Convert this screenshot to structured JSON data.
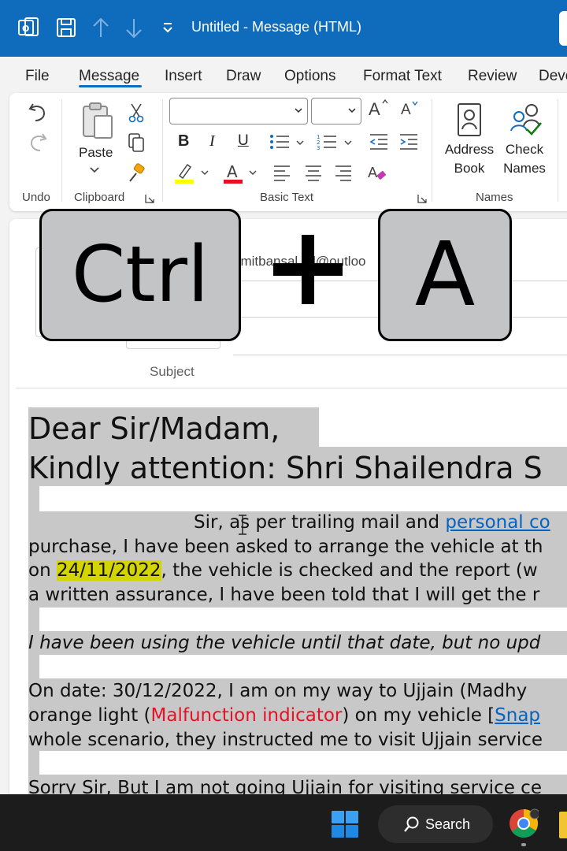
{
  "titlebar": {
    "title": "Untitled  -  Message (HTML)",
    "bg_color": "#0f6cbd"
  },
  "menu": {
    "tabs": [
      "File",
      "Message",
      "Insert",
      "Draw",
      "Options",
      "Format Text",
      "Review",
      "Deve"
    ],
    "active": "Message"
  },
  "ribbon": {
    "groups": {
      "undo": "Undo",
      "clipboard": "Clipboard",
      "basic_text": "Basic Text",
      "names": "Names"
    },
    "paste_label": "Paste",
    "bold": "B",
    "italic": "I",
    "underline": "U",
    "address_book": [
      "Address",
      "Book"
    ],
    "check_names": [
      "Check",
      "Names"
    ],
    "grow_font": "A",
    "shrink_font": "A"
  },
  "compose": {
    "to_value": "amitbansal_ol@outloo",
    "subject_label": "Subject"
  },
  "shortcut_overlay": {
    "key1": "Ctrl",
    "plus": "+",
    "key2": "A"
  },
  "email_body": {
    "greeting": "Dear Sir/Madam,",
    "attention": "Kindly attention: Shri Shailendra S",
    "p1_line1_a": "Sir, as per trailing mail and ",
    "p1_line1_link": "personal co",
    "p1_line2": "purchase, I have been asked to arrange the vehicle at th",
    "p1_line3_a": "on ",
    "p1_line3_date": "24/11/2022",
    "p1_line3_b": ", the vehicle is checked and the report (w",
    "p1_line4": "a written assurance, I have been told that I will get the r",
    "p2": "I have been using the vehicle until that date, but no upd",
    "p3_line1": "On date: 30/12/2022, I am on my way to Ujjain (Madhy",
    "p3_line2_a": "orange light (",
    "p3_line2_red": "Malfunction indicator",
    "p3_line2_b": ") on my vehicle [",
    "p3_line2_link": "Snap",
    "p3_line3": "whole scenario, they instructed me to visit Ujjain service",
    "p4": "Sorry Sir, But I am not going Ujjain for visiting service ce"
  },
  "taskbar": {
    "search_label": "Search"
  }
}
